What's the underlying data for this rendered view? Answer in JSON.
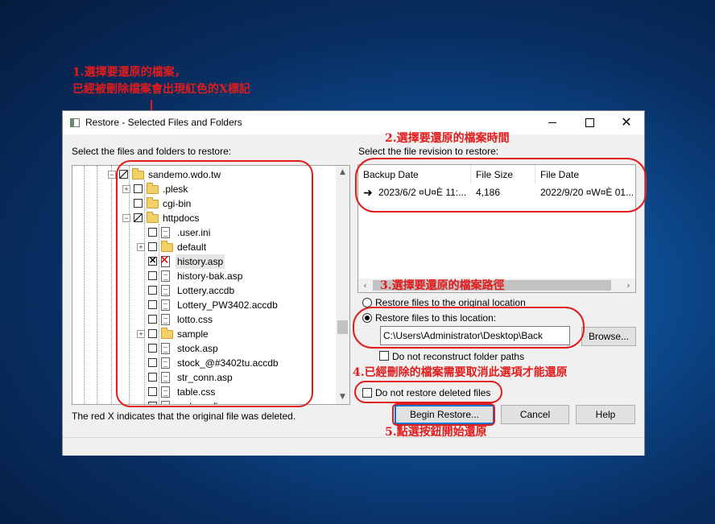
{
  "annotations": {
    "a1_line1": "1.選擇要還原的檔案，",
    "a1_line2": "已經被刪除檔案會出現紅色的X標記",
    "a2": "2.選擇要還原的檔案時間",
    "a3": "3.選擇要還原的檔案路徑",
    "a4": "4.已經刪除的檔案需要取消此選項才能還原",
    "a5": "5.點選按鈕開始還原"
  },
  "window": {
    "title": "Restore - Selected Files and Folders",
    "minimize": "–",
    "maximize": "□",
    "close": "✕"
  },
  "left": {
    "label": "Select the files and folders to restore:",
    "tree": [
      {
        "name": "sandemo.wdo.tw",
        "type": "folder",
        "state": "partial",
        "expander": "−"
      },
      {
        "name": ".plesk",
        "type": "folder",
        "state": "unchecked",
        "expander": "+"
      },
      {
        "name": "cgi-bin",
        "type": "folder",
        "state": "unchecked",
        "expander": ""
      },
      {
        "name": "httpdocs",
        "type": "folder",
        "state": "partial",
        "expander": "−"
      },
      {
        "name": ".user.ini",
        "type": "file",
        "state": "unchecked",
        "expander": ""
      },
      {
        "name": "default",
        "type": "folder",
        "state": "unchecked",
        "expander": "+"
      },
      {
        "name": "history.asp",
        "type": "deleted-file",
        "state": "checked",
        "expander": ""
      },
      {
        "name": "history-bak.asp",
        "type": "file",
        "state": "unchecked",
        "expander": ""
      },
      {
        "name": "Lottery.accdb",
        "type": "file",
        "state": "unchecked",
        "expander": ""
      },
      {
        "name": "Lottery_PW3402.accdb",
        "type": "file",
        "state": "unchecked",
        "expander": ""
      },
      {
        "name": "lotto.css",
        "type": "file",
        "state": "unchecked",
        "expander": ""
      },
      {
        "name": "sample",
        "type": "folder",
        "state": "unchecked",
        "expander": "+"
      },
      {
        "name": "stock.asp",
        "type": "file",
        "state": "unchecked",
        "expander": ""
      },
      {
        "name": "stock_@#3402tu.accdb",
        "type": "file",
        "state": "unchecked",
        "expander": ""
      },
      {
        "name": "str_conn.asp",
        "type": "file",
        "state": "unchecked",
        "expander": ""
      },
      {
        "name": "table.css",
        "type": "file",
        "state": "unchecked",
        "expander": ""
      },
      {
        "name": "web.config",
        "type": "file",
        "state": "unchecked",
        "expander": ""
      }
    ],
    "footnote": "The red X indicates that the original file was deleted."
  },
  "right": {
    "label": "Select the file revision to restore:",
    "columns": [
      "Backup Date",
      "File Size",
      "File Date"
    ],
    "rows": [
      {
        "backup_date": "2023/6/2 ¤U¤È 11:...",
        "size": "4,186",
        "file_date": "2022/9/20 ¤W¤È 01..."
      }
    ],
    "restore_original": "Restore files to the original location",
    "restore_location": "Restore files to this location:",
    "location_value": "C:\\Users\\Administrator\\Desktop\\Back",
    "browse": "Browse...",
    "no_reconstruct": "Do not reconstruct folder paths",
    "no_restore_deleted": "Do not restore deleted files",
    "begin": "Begin Restore...",
    "cancel": "Cancel",
    "help": "Help"
  }
}
